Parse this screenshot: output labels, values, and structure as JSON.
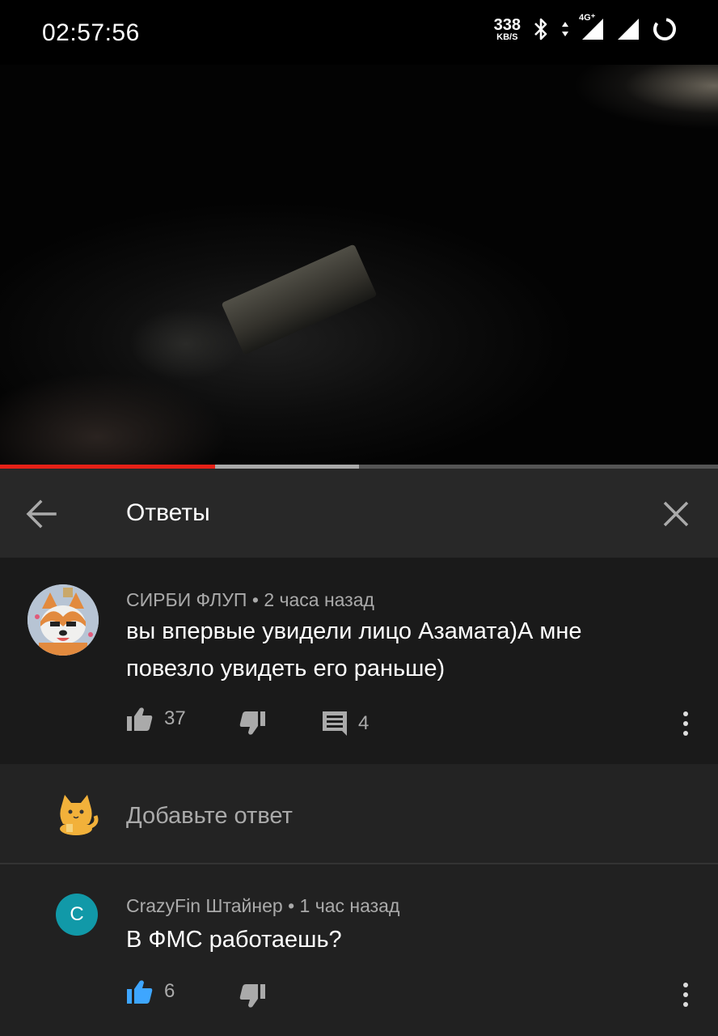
{
  "status_bar": {
    "time": "02:57:56",
    "net_speed": "338",
    "net_unit": "KB/S",
    "network": "4G⁺",
    "icons": [
      "bluetooth-icon",
      "data-arrows-icon",
      "signal-icon",
      "signal-icon",
      "battery-ring-icon"
    ]
  },
  "player": {
    "played_fraction": 0.3,
    "buffered_fraction": 0.5
  },
  "header": {
    "title": "Ответы",
    "back_icon": "arrow-left-icon",
    "close_icon": "close-icon"
  },
  "comment": {
    "author": "СИРБИ ФЛУП",
    "separator": "•",
    "time": "2 часа назад",
    "text_line1": "вы впервые увидели лицо Азамата)А мне",
    "text_line2": "повезло увидеть его раньше)",
    "likes": "37",
    "replies": "4"
  },
  "reply_input": {
    "placeholder": "Добавьте ответ"
  },
  "reply": {
    "avatar_letter": "C",
    "author": "CrazyFin Штайнер",
    "separator": "•",
    "time": "1 час назад",
    "text": "В ФМС работаешь?",
    "likes": "6"
  },
  "colors": {
    "progress_played": "#e62117",
    "avatar_teal": "#1199a8",
    "like_active": "#3ea6ff"
  }
}
